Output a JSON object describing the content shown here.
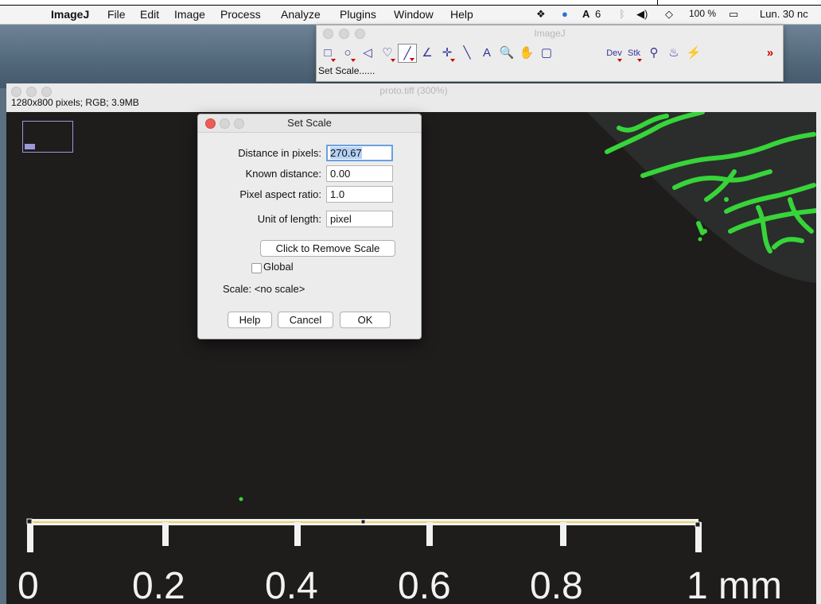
{
  "menubar": {
    "app": "ImageJ",
    "items": [
      "File",
      "Edit",
      "Image",
      "Process",
      "Analyze",
      "Plugins",
      "Window",
      "Help"
    ],
    "status": {
      "n6": "6",
      "battery": "100 %",
      "clock": "Lun. 30 nc"
    }
  },
  "toolbar": {
    "title": "ImageJ",
    "status": "Set Scale......",
    "tools": [
      "□",
      "○",
      "◁",
      "♡",
      "╱",
      "∠",
      "✛",
      "╲",
      "A",
      "🔍",
      "✋",
      "▢",
      "Dev",
      "Stk",
      "⚲",
      "♨",
      "⚡",
      "",
      "",
      "»"
    ]
  },
  "image_window": {
    "title": "proto.tiff (300%)",
    "info": "1280x800 pixels; RGB; 3.9MB",
    "scalebar": {
      "labels": [
        "0",
        "0.2",
        "0.4",
        "0.6",
        "0.8",
        "1 mm"
      ]
    }
  },
  "dialog": {
    "title": "Set Scale",
    "distance_label": "Distance in pixels:",
    "distance_value": "270.67",
    "known_label": "Known distance:",
    "known_value": "0.00",
    "aspect_label": "Pixel aspect ratio:",
    "aspect_value": "1.0",
    "unit_label": "Unit of length:",
    "unit_value": "pixel",
    "remove_scale": "Click to Remove Scale",
    "global_label": "Global",
    "scale_text": "Scale: <no scale>",
    "help": "Help",
    "cancel": "Cancel",
    "ok": "OK"
  }
}
